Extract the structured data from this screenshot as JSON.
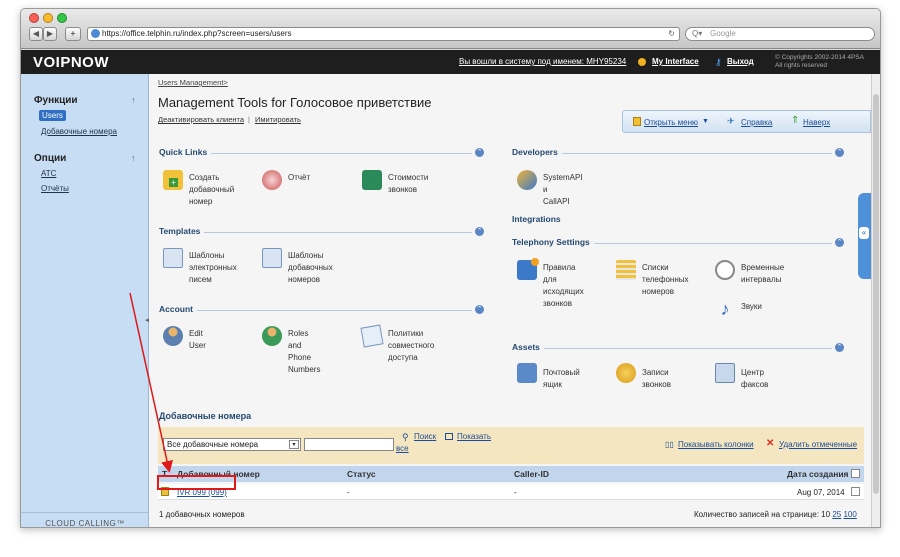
{
  "browser": {
    "url": "https://office.telphin.ru/index.php?screen=users/users",
    "search_placeholder": "Google",
    "back": "◀",
    "forward": "▶",
    "add": "+"
  },
  "header": {
    "logo": "VOIPNOW",
    "logged_in": "Вы вошли в систему под именем: MHY95234",
    "my_interface": "My Interface",
    "logout": "Выход",
    "copyright_1": "© Copyrights 2002-2014 4PSA",
    "copyright_2": "All rights reserved"
  },
  "sidebar": {
    "functions_title": "Функции",
    "users": "Users",
    "extensions": "Добавочные номера",
    "options_title": "Опции",
    "ats": "АТС",
    "reports": "Отчёты",
    "footer": "CLOUD CALLING™"
  },
  "page": {
    "breadcrumb": "Users Management>",
    "title": "Management Tools for Голосовое приветствие",
    "deactivate": "Деактивировать клиента",
    "sep": "|",
    "imitate": "Имитировать",
    "open_menu": "Открыть меню",
    "help": "Справка",
    "top": "Наверх"
  },
  "sections": {
    "quick_links": "Quick Links",
    "templates": "Templates",
    "account": "Account",
    "developers": "Developers",
    "integrations": "Integrations",
    "telephony": "Telephony Settings",
    "assets": "Assets"
  },
  "items": {
    "create_ext": "Создать\nдобавочный\nномер",
    "report": "Отчёт",
    "call_cost": "Стоимости\nзвонков",
    "email_tpl": "Шаблоны\nэлектронных\nписем",
    "ext_tpl": "Шаблоны\nдобавочных\nномеров",
    "edit_user": "Edit User",
    "roles": "Roles and Phone\nNumbers",
    "policies": "Политики\nсовместного\nдоступа",
    "systemapi": "SystemAPI и\nCallAPI",
    "outgoing": "Правила для\nисходящих\nзвонков",
    "phone_lists": "Списки\nтелефонных\nномеров",
    "intervals": "Временные\nинтервалы",
    "sounds": "Звуки",
    "mailbox": "Почтовый ящик",
    "recordings": "Записи звонков",
    "fax": "Центр факсов"
  },
  "list": {
    "title": "Добавочные номера",
    "filter_value": "Все добавочные номера",
    "search": "Поиск",
    "show_all_1": "Показать",
    "show_all_2": "все",
    "show_columns": "Показывать колонки",
    "delete_selected": "Удалить отмеченные",
    "col_t": "T",
    "col_ext": "Добавочный номер",
    "col_status": "Статус",
    "col_callerid": "Caller-ID",
    "col_created": "Дата создания",
    "row_ext": "IVR 099 (099)",
    "row_status": "-",
    "row_callerid": "-",
    "row_created": "Aug 07, 2014",
    "total": "1 добавочных номеров",
    "per_page_label": "Количество записей на странице: 10",
    "per_page_25": "25",
    "per_page_100": "100"
  },
  "colors": {
    "header_bg": "#1e1e1e",
    "sidebar_bg": "#c6ddf4",
    "section_title": "#24496f",
    "link": "#1d4d9a",
    "filter_bg": "#f3e6c0",
    "highlight": "#e01818"
  }
}
